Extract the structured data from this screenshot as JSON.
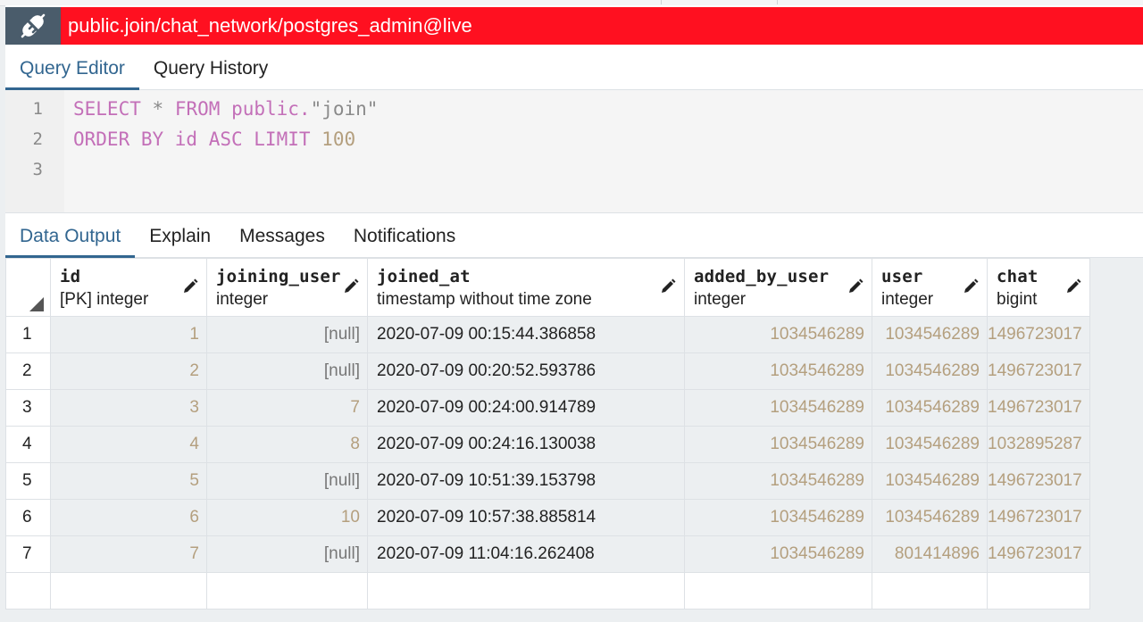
{
  "connection": {
    "title": "public.join/chat_network/postgres_admin@live",
    "icon": "disconnect-plug-icon",
    "bar_color": "#ff1020"
  },
  "editor_tabs": [
    {
      "label": "Query Editor",
      "active": true
    },
    {
      "label": "Query History",
      "active": false
    }
  ],
  "query": {
    "line_numbers": [
      "1",
      "2",
      "3"
    ],
    "line1": {
      "kw1": "SELECT",
      "op": "*",
      "kw2": "FROM",
      "kw3": "public.",
      "str": "\"join\""
    },
    "line2": {
      "kw1": "ORDER BY id ASC LIMIT",
      "num": "100"
    }
  },
  "output_tabs": [
    {
      "label": "Data Output",
      "active": true
    },
    {
      "label": "Explain",
      "active": false
    },
    {
      "label": "Messages",
      "active": false
    },
    {
      "label": "Notifications",
      "active": false
    }
  ],
  "grid": {
    "columns": [
      {
        "name": "id",
        "type": "[PK] integer"
      },
      {
        "name": "joining_user",
        "type": "integer"
      },
      {
        "name": "joined_at",
        "type": "timestamp without time zone"
      },
      {
        "name": "added_by_user",
        "type": "integer"
      },
      {
        "name": "user",
        "type": "integer"
      },
      {
        "name": "chat",
        "type": "bigint"
      }
    ],
    "rows": [
      {
        "n": "1",
        "id": "1",
        "joining_user": "[null]",
        "joined_at": "2020-07-09 00:15:44.386858",
        "added_by_user": "1034546289",
        "user": "1034546289",
        "chat": "1496723017"
      },
      {
        "n": "2",
        "id": "2",
        "joining_user": "[null]",
        "joined_at": "2020-07-09 00:20:52.593786",
        "added_by_user": "1034546289",
        "user": "1034546289",
        "chat": "1496723017"
      },
      {
        "n": "3",
        "id": "3",
        "joining_user": "7",
        "joined_at": "2020-07-09 00:24:00.914789",
        "added_by_user": "1034546289",
        "user": "1034546289",
        "chat": "1496723017"
      },
      {
        "n": "4",
        "id": "4",
        "joining_user": "8",
        "joined_at": "2020-07-09 00:24:16.130038",
        "added_by_user": "1034546289",
        "user": "1034546289",
        "chat": "1032895287"
      },
      {
        "n": "5",
        "id": "5",
        "joining_user": "[null]",
        "joined_at": "2020-07-09 10:51:39.153798",
        "added_by_user": "1034546289",
        "user": "1034546289",
        "chat": "1496723017"
      },
      {
        "n": "6",
        "id": "6",
        "joining_user": "10",
        "joined_at": "2020-07-09 10:57:38.885814",
        "added_by_user": "1034546289",
        "user": "1034546289",
        "chat": "1496723017"
      },
      {
        "n": "7",
        "id": "7",
        "joining_user": "[null]",
        "joined_at": "2020-07-09 11:04:16.262408",
        "added_by_user": "1034546289",
        "user": "801414896",
        "chat": "1496723017"
      }
    ]
  },
  "colors": {
    "accent": "#326690",
    "keyword": "#c36fb8",
    "number": "#b49f7e"
  }
}
